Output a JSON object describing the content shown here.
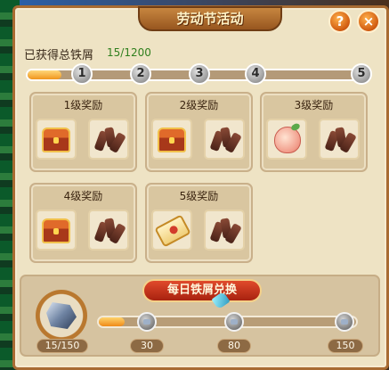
{
  "window": {
    "title": "劳动节活动",
    "help_label": "?",
    "close_label": "×"
  },
  "progress": {
    "label": "已获得总铁屑",
    "value_text": "15/1200",
    "fill_fraction": 0.012,
    "level_nodes": [
      "1",
      "2",
      "3",
      "4",
      "5"
    ]
  },
  "rewards": [
    {
      "title": "1级奖励",
      "items": [
        "treasure-chest-icon",
        "iron-scrap-icon"
      ]
    },
    {
      "title": "2级奖励",
      "items": [
        "treasure-chest-icon",
        "iron-scrap-icon"
      ]
    },
    {
      "title": "3级奖励",
      "items": [
        "peach-icon",
        "iron-scrap-icon"
      ]
    },
    {
      "title": "4级奖励",
      "items": [
        "treasure-chest-icon",
        "iron-scrap-icon"
      ]
    },
    {
      "title": "5级奖励",
      "items": [
        "scroll-icon",
        "iron-scrap-icon"
      ]
    }
  ],
  "exchange": {
    "button_label": "每日铁屑兑换",
    "current": "15/150",
    "fill_fraction": 0.1,
    "milestones": [
      "30",
      "80",
      "150"
    ]
  },
  "colors": {
    "accent": "#f0951d",
    "window_bg": "#eee3c4",
    "border": "#a86b32",
    "button_red": "#c0301a",
    "value_green": "#2f7f1d"
  }
}
